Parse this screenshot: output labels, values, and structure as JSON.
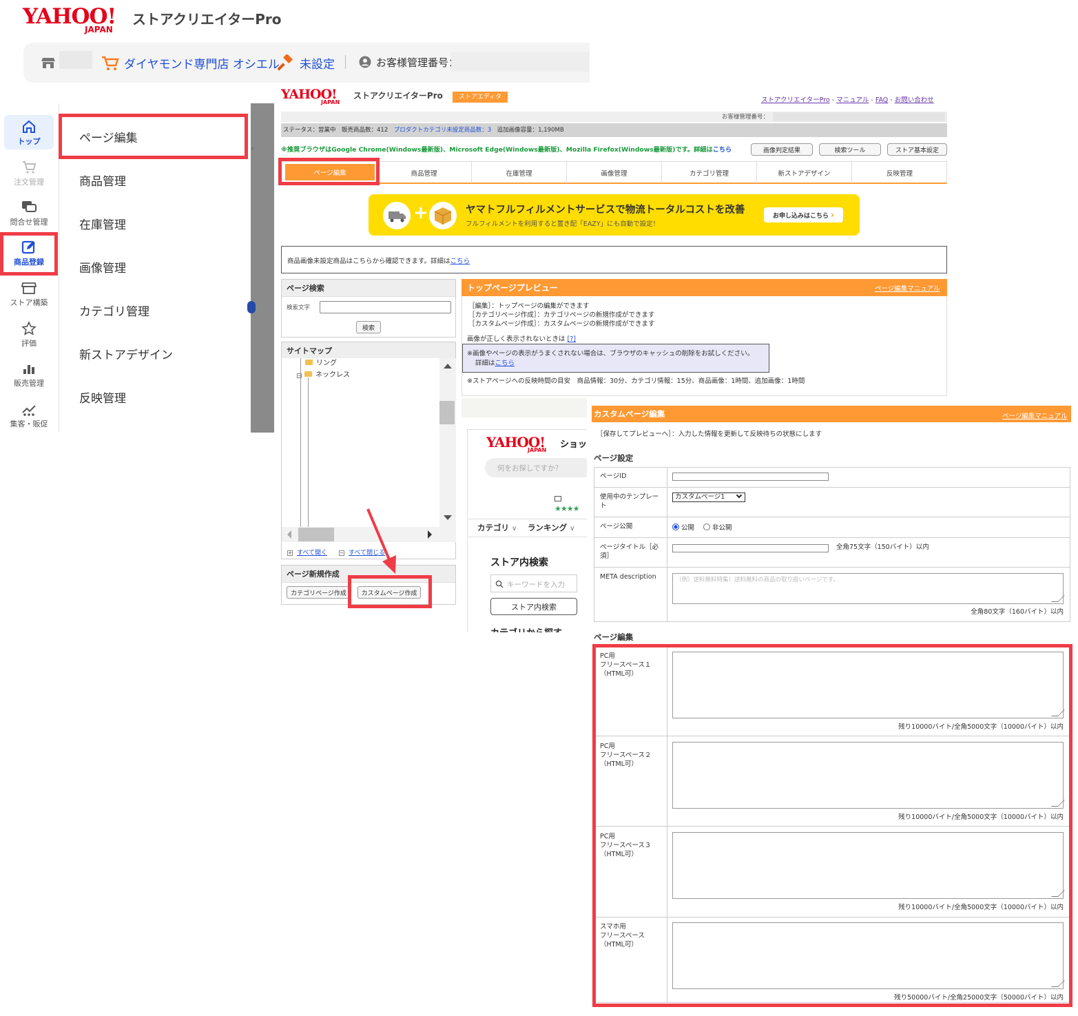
{
  "top_header": {
    "logo_text": "YAHOO!",
    "logo_sub": "JAPAN",
    "app_name": "ストアクリエイターPro",
    "store_name": "ダイヤモンド専門店 オシエル",
    "auction_status": "未設定",
    "customer_id_label": "お客様管理番号："
  },
  "left_sidebar": {
    "items": [
      {
        "label": "トップ",
        "icon": "home-icon"
      },
      {
        "label": "注文管理",
        "icon": "cart-icon"
      },
      {
        "label": "問合せ管理",
        "icon": "chat-icon"
      },
      {
        "label": "商品登録",
        "icon": "edit-icon"
      },
      {
        "label": "ストア構築",
        "icon": "store-icon"
      },
      {
        "label": "評価",
        "icon": "star-icon"
      },
      {
        "label": "販売管理",
        "icon": "bar-chart-icon"
      },
      {
        "label": "集客・販促",
        "icon": "growth-icon"
      }
    ]
  },
  "submenu": {
    "items": [
      "ページ編集",
      "商品管理",
      "在庫管理",
      "画像管理",
      "カテゴリ管理",
      "新ストアデザイン",
      "反映管理"
    ]
  },
  "editor_header": {
    "logo_text": "YAHOO!",
    "logo_sub": "JAPAN",
    "app_name": "ストアクリエイターPro",
    "badge": "ストアエディタ",
    "links": [
      "ストアクリエイターPro",
      "マニュアル",
      "FAQ",
      "お問い合わせ"
    ],
    "link_sep": " - ",
    "customer_id_label": "お客様管理番号：",
    "status_prefix": "ステータス：営業中　販売商品数：412　",
    "status_link": "プロダクトカテゴリ未設定商品数：3",
    "status_suffix": "　追加画像容量：1,190MB",
    "recommend_text": "※推奨ブラウザはGoogle Chrome(Windows最新版)、Microsoft Edge(Windows最新版)、Mozilla Firefox(Windows最新版)です。詳細は",
    "recommend_link": "こちら",
    "buttons": [
      "画像判定結果",
      "検索ツール",
      "ストア基本設定"
    ]
  },
  "editor_nav": {
    "tabs": [
      "ページ編集",
      "商品管理",
      "在庫管理",
      "画像管理",
      "カテゴリ管理",
      "新ストアデザイン",
      "反映管理"
    ]
  },
  "banner": {
    "title": "ヤマトフルフィルメントサービスで物流トータルコストを改善",
    "subtitle": "フルフィルメントを利用すると置き配「EAZY」にも自動で設定！",
    "cta": "お申し込みはこちら",
    "cta_arrow": "›",
    "plus": "+"
  },
  "notice": {
    "text": "商品画像未設定商品はこちらから確認できます。詳細は",
    "link": "こちら"
  },
  "page_search": {
    "title": "ページ検索",
    "label": "検索文字",
    "button": "検索"
  },
  "sitemap": {
    "title": "サイトマップ",
    "folders": [
      "リング",
      "ネックレス"
    ],
    "expand_all": "すべて開く",
    "collapse_all": "すべて閉じる",
    "expand_icon": "+",
    "collapse_icon": "−"
  },
  "new_page": {
    "title": "ページ新規作成",
    "category_button": "カテゴリページ作成",
    "custom_button": "カスタムページ作成"
  },
  "preview": {
    "title": "トップページプレビュー",
    "manual_link": "ページ編集マニュアル",
    "lines": [
      "［編集］：トップページの編集ができます",
      "［カテゴリページ作成］：カテゴリページの新規作成ができます",
      "［カスタムページ作成］：カスタムページの新規作成ができます"
    ],
    "image_note": "画像が正しく表示されないときは",
    "image_note_link": "[?]",
    "cache_note": "※画像やページの表示がうまくされない場合は、ブラウザのキャッシュの削除をお試しください。",
    "cache_detail": "詳細は",
    "cache_link": "こちら",
    "timing_note": "※ストアページへの反映時間の目安　商品情報：30分、カテゴリ情報：15分、商品画像：1時間、追加画像：1時間"
  },
  "store_preview": {
    "logo_text": "YAHOO!",
    "logo_sub": "JAPAN",
    "shopping": "ショッ",
    "search_placeholder": "何をお探しですか？",
    "stars": "★★★★",
    "nav": [
      "カテゴリ",
      "ランキング"
    ],
    "chevron": "∨",
    "store_search_title": "ストア内検索",
    "keyword_placeholder": "キーワードを入力",
    "search_button": "ストア内検索",
    "category_heading": "カテゴリから探す"
  },
  "custom_edit": {
    "title": "カスタムページ編集",
    "manual_link": "ページ編集マニュアル",
    "save_note": "［保存してプレビューへ］：入力した情報を更新して反映待ちの状態にします",
    "settings_title": "ページ設定",
    "page_id_label": "ページID",
    "template_label": "使用中のテンプレート",
    "template_value": "カスタムページ1",
    "publish_label": "ページ公開",
    "publish_options": [
      "公開",
      "非公開"
    ],
    "title_label": "ページタイトル［必須］",
    "title_hint": "全角75文字（150バイト）以内",
    "meta_label": "META description",
    "meta_placeholder": "（例）送料無料特集！送料無料の商品の取り扱いページです。",
    "meta_hint": "全角80文字（160バイト）以内",
    "edit_title": "ページ編集",
    "free_spaces": [
      {
        "label": "PC用\nフリースペース１\n（HTML可）",
        "hint": "残り10000バイト/全角5000文字（10000バイト）以内"
      },
      {
        "label": "PC用\nフリースペース２\n（HTML可）",
        "hint": "残り10000バイト/全角5000文字（10000バイト）以内"
      },
      {
        "label": "PC用\nフリースペース３\n（HTML可）",
        "hint": "残り10000バイト/全角5000文字（10000バイト）以内"
      },
      {
        "label": "スマホ用\nフリースペース\n（HTML可）",
        "hint": "残り50000バイト/全角25000文字（50000バイト）以内"
      }
    ]
  },
  "colors": {
    "accent_orange": "#ff9933",
    "highlight_red": "#f03c46",
    "yahoo_red": "#e60019",
    "link_blue": "#1f4fd6",
    "banner_yellow": "#ffdd00",
    "recommend_green": "#1a9a3b"
  }
}
